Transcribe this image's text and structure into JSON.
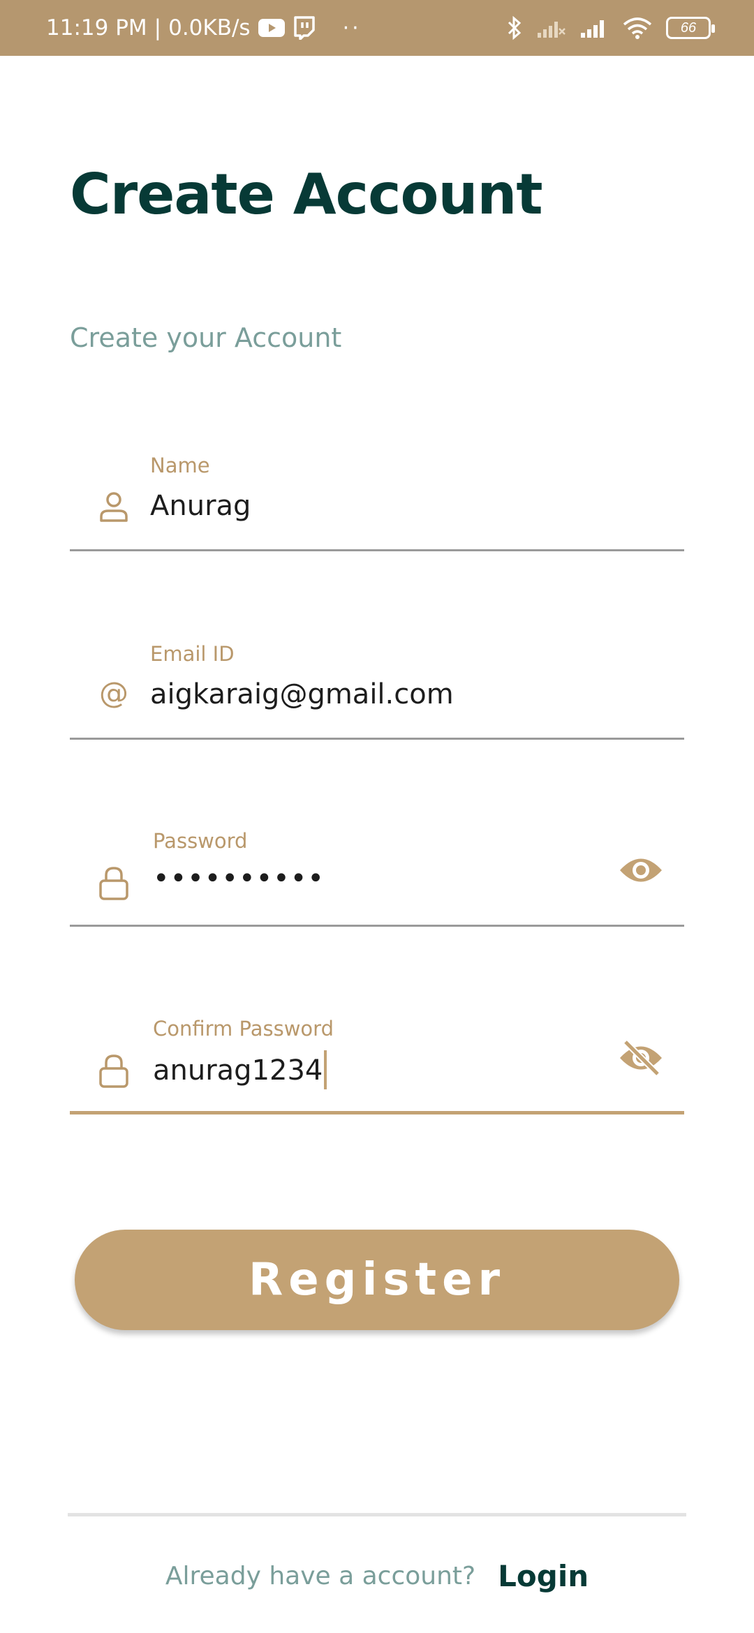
{
  "status_bar": {
    "time": "11:19 PM",
    "network_speed": "0.0KB/s",
    "separator": "|",
    "overflow": "··",
    "battery": "66",
    "background": "#b5976f"
  },
  "header": {
    "title": "Create Account",
    "subtitle": "Create your Account"
  },
  "form": {
    "name": {
      "label": "Name",
      "value": "Anurag",
      "icon": "person-icon"
    },
    "email": {
      "label": "Email ID",
      "value": "aigkaraig@gmail.com",
      "icon": "at-icon"
    },
    "password": {
      "label": "Password",
      "value": "••••••••••",
      "icon": "lock-icon",
      "toggle_icon": "eye-icon"
    },
    "confirm_password": {
      "label": "Confirm Password",
      "value": "anurag1234",
      "icon": "lock-icon",
      "toggle_icon": "eye-off-icon"
    }
  },
  "register_label": "Register",
  "footer": {
    "question": "Already have a account?",
    "login_label": "Login"
  },
  "colors": {
    "accent": "#c3a274",
    "title": "#073a36",
    "muted": "#7a9e9a"
  }
}
